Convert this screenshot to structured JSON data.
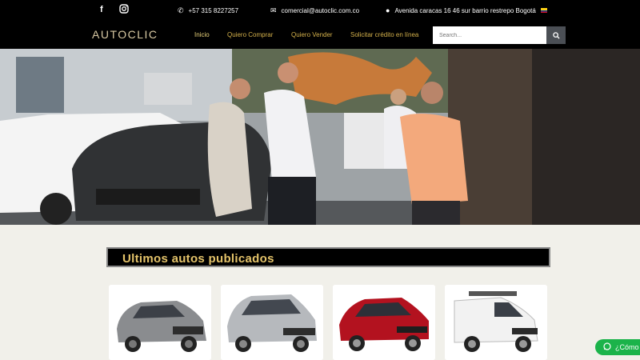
{
  "topbar": {
    "facebook_icon": "facebook-icon",
    "instagram_icon": "instagram-icon",
    "phone": "+57 315 8227257",
    "email": "comercial@autoclic.com.co",
    "address": "Avenida caracas 16 46 sur barrio restrepo Bogotá"
  },
  "header": {
    "logo_text": "AUTOCLIC",
    "nav": [
      "Inicio",
      "Quiero Comprar",
      "Quiero Vender",
      "Solicitar crédito en línea"
    ],
    "search_placeholder": "Search...",
    "accent_color": "#d4b14b"
  },
  "section": {
    "title": "Ultimos autos publicados"
  },
  "cards": [
    {
      "car_color": "#8a8c8f"
    },
    {
      "car_color": "#b6b9bd"
    },
    {
      "car_color": "#b3121f"
    },
    {
      "car_color": "#f2f2f2"
    }
  ],
  "whatsapp": {
    "label": "¿Cómo p"
  }
}
